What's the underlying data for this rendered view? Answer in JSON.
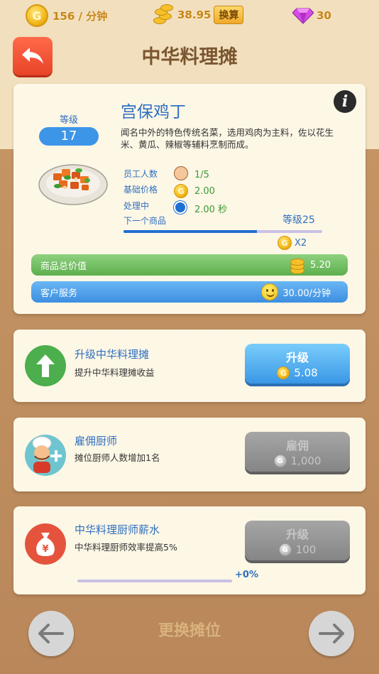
{
  "topbar": {
    "income_rate": "156 / 分钟",
    "coins": "38.95",
    "exchange_label": "换算",
    "gems": "30"
  },
  "header": {
    "title": "中华料理摊"
  },
  "dish_card": {
    "level_label": "等级",
    "level_value": "17",
    "name": "宫保鸡丁",
    "description": "闻名中外的特色传统名菜，选用鸡肉为主料，佐以花生米、黄瓜、辣椒等辅料烹制而成。",
    "staff_label": "员工人数",
    "staff_value": "1/5",
    "base_price_label": "基础价格",
    "base_price_value": "2.00",
    "processing_label": "处理中",
    "processing_value": "2.00 秒",
    "next_item_label": "下一个商品",
    "next_level": "等级25",
    "next_progress": 0.67,
    "multiplier": "X2",
    "total_value_label": "商品总价值",
    "total_value": "5.20",
    "service_label": "客户服务",
    "service_value": "30.00/分钟"
  },
  "upgrades": [
    {
      "title": "升级中华料理摊",
      "subtitle": "提升中华料理摊收益",
      "button_label": "升级",
      "button_cost": "5.08",
      "enabled": true
    },
    {
      "title": "雇佣厨师",
      "subtitle": "摊位厨师人数增加1名",
      "button_label": "雇佣",
      "button_cost": "1,000",
      "enabled": false
    },
    {
      "title": "中华料理厨师薪水",
      "subtitle": "中华料理厨师效率提高5%",
      "button_label": "升级",
      "button_cost": "100",
      "enabled": false,
      "progress_text": "+0%"
    }
  ],
  "footer": {
    "switch_label": "更换摊位"
  },
  "colors": {
    "accent_blue": "#2f6fc0",
    "back_button": "#e84328",
    "green_bar": "#5daf4d",
    "blue_bar": "#3d8ee0"
  }
}
